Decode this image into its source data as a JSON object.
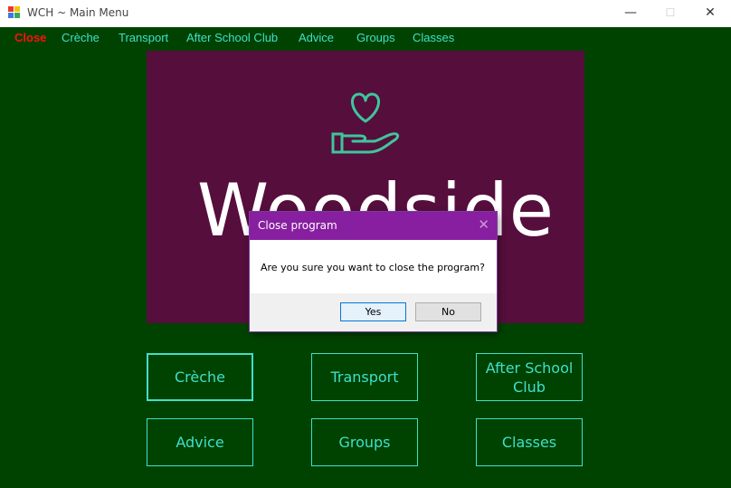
{
  "window": {
    "title": "WCH ~ Main Menu",
    "controls": {
      "minimize": "—",
      "maximize": "☐",
      "close": "✕"
    }
  },
  "menu": {
    "items": [
      {
        "label": "Close"
      },
      {
        "label": "Crèche"
      },
      {
        "label": "Transport"
      },
      {
        "label": "After School Club"
      },
      {
        "label": "Advice"
      },
      {
        "label": "Groups"
      },
      {
        "label": "Classes"
      }
    ]
  },
  "banner": {
    "logo_icon": "heart-in-hand-icon",
    "word": "Woodside",
    "background": "#560e3c",
    "accent": "#3fc59c"
  },
  "tiles": [
    {
      "label": "Crèche"
    },
    {
      "label": "Transport"
    },
    {
      "label": "After School Club"
    },
    {
      "label": "Advice"
    },
    {
      "label": "Groups"
    },
    {
      "label": "Classes"
    }
  ],
  "dialog": {
    "title": "Close program",
    "close_glyph": "✕",
    "message": "Are you sure you want to close the program?",
    "yes_label": "Yes",
    "no_label": "No",
    "title_color": "#871fa0"
  },
  "colors": {
    "background": "#004200",
    "accent": "#3fe0c8",
    "danger": "#ff1010"
  }
}
